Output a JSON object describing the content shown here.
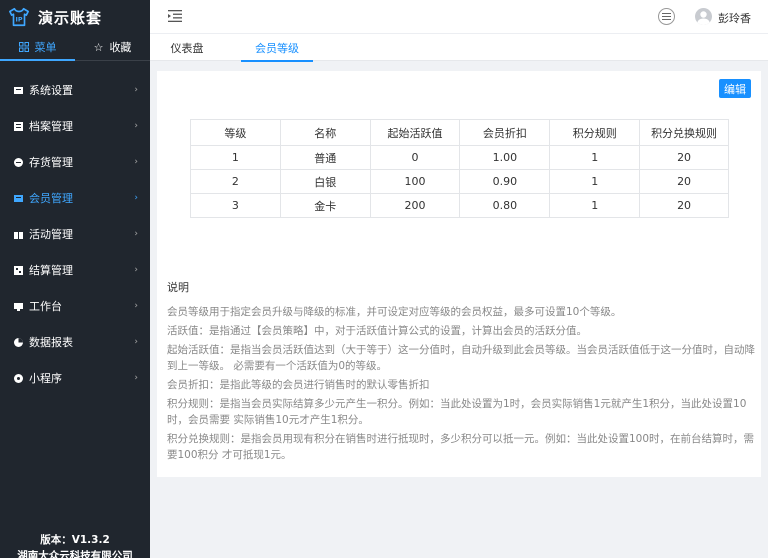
{
  "brand": {
    "name": "演示账套"
  },
  "sidebar": {
    "tabs": [
      {
        "label": "菜单",
        "icon": "grid-icon",
        "active": true
      },
      {
        "label": "收藏",
        "icon": "star-icon",
        "active": false
      }
    ],
    "items": [
      {
        "label": "系统设置",
        "icon": "settings-icon",
        "active": false
      },
      {
        "label": "档案管理",
        "icon": "archive-icon",
        "active": false
      },
      {
        "label": "存货管理",
        "icon": "inventory-icon",
        "active": false
      },
      {
        "label": "会员管理",
        "icon": "member-icon",
        "active": true
      },
      {
        "label": "活动管理",
        "icon": "gift-icon",
        "active": false
      },
      {
        "label": "结算管理",
        "icon": "settlement-icon",
        "active": false
      },
      {
        "label": "工作台",
        "icon": "workbench-icon",
        "active": false
      },
      {
        "label": "数据报表",
        "icon": "report-icon",
        "active": false
      },
      {
        "label": "小程序",
        "icon": "miniapp-icon",
        "active": false
      }
    ],
    "version": "版本：V1.3.2",
    "company": "湖南大众云科技有限公司"
  },
  "topbar": {
    "username": "彭玲香"
  },
  "tabs": [
    {
      "label": "仪表盘",
      "active": false
    },
    {
      "label": "会员等级",
      "active": true
    }
  ],
  "content": {
    "edit_label": "编辑",
    "table": {
      "headers": [
        "等级",
        "名称",
        "起始活跃值",
        "会员折扣",
        "积分规则",
        "积分兑换规则"
      ],
      "rows": [
        [
          "1",
          "普通",
          "0",
          "1.00",
          "1",
          "20"
        ],
        [
          "2",
          "白银",
          "100",
          "0.90",
          "1",
          "20"
        ],
        [
          "3",
          "金卡",
          "200",
          "0.80",
          "1",
          "20"
        ]
      ]
    },
    "description": {
      "title": "说明",
      "lines": [
        "会员等级用于指定会员升级与降级的标准，并可设定对应等级的会员权益，最多可设置10个等级。",
        "活跃值：是指通过【会员策略】中，对于活跃值计算公式的设置，计算出会员的活跃分值。",
        "起始活跃值：是指当会员活跃值达到（大于等于）这一分值时，自动升级到此会员等级。当会员活跃值低于这一分值时，自动降到上一等级。 必需要有一个活跃值为0的等级。",
        "会员折扣：是指此等级的会员进行销售时的默认零售折扣",
        "积分规则：是指当会员实际结算多少元产生一积分。例如：当此处设置为1时，会员实际销售1元就产生1积分，当此处设置10时，会员需要 实际销售10元才产生1积分。",
        "积分兑换规则：是指会员用现有积分在销售时进行抵现时，多少积分可以抵一元。例如：当此处设置100时，在前台结算时，需要100积分 才可抵现1元。"
      ]
    }
  },
  "colors": {
    "sidebar_bg": "#20262e",
    "accent": "#1890ff"
  }
}
